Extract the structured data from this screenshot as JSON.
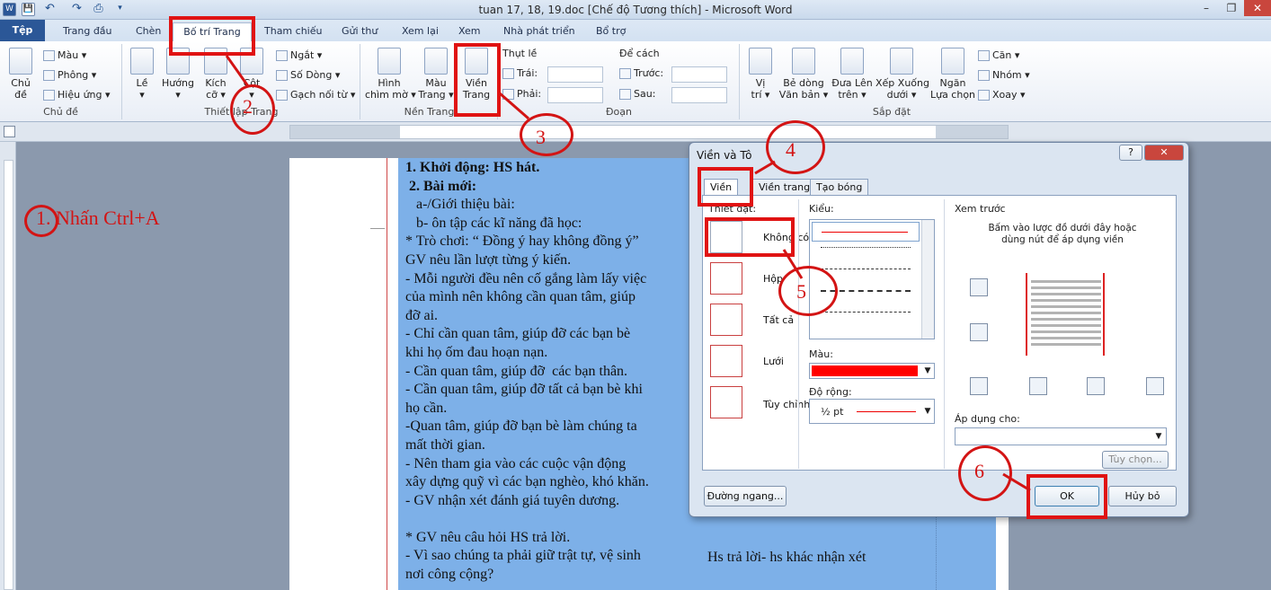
{
  "window": {
    "title": "tuan 17, 18, 19.doc [Chế độ Tương thích] - Microsoft Word",
    "minimize": "–",
    "restore": "❐",
    "close": "✕"
  },
  "qat": {
    "word_icon": "W",
    "save_icon": "💾",
    "undo_icon": "↶",
    "redo_icon": "↷",
    "print_icon": "⎙",
    "customize_icon": "▾"
  },
  "tabs": [
    "Tệp",
    "Trang đầu",
    "Chèn",
    "Bố trí Trang",
    "Tham chiếu",
    "Gửi thư",
    "Xem lại",
    "Xem",
    "Nhà phát triển",
    "Bổ trợ"
  ],
  "ribbon": {
    "themes": {
      "label": "Chủ đề",
      "big": "Chủ\nđề",
      "colors": "Màu ▾",
      "fonts": "Phông ▾",
      "effects": "Hiệu ứng ▾"
    },
    "page_setup": {
      "label": "Thiết lập Trang",
      "margins": "Lề\n▾",
      "orientation": "Hướng\n▾",
      "size": "Kích\ncỡ ▾",
      "columns": "Cột\n▾",
      "breaks": "Ngắt ▾",
      "line_numbers": "Số Dòng ▾",
      "hyphenation": "Gạch nối từ ▾"
    },
    "page_bg": {
      "label": "Nền Trang",
      "watermark": "Hình\nchìm mờ ▾",
      "page_color": "Màu\nTrang ▾",
      "page_borders": "Viền\nTrang"
    },
    "paragraph": {
      "label": "Đoạn",
      "indent": "Thụt lề",
      "left": "Trái:",
      "right": "Phải:",
      "spacing": "Để cách",
      "before": "Trước:",
      "after": "Sau:"
    },
    "arrange": {
      "label": "Sắp đặt",
      "position": "Vị\ntrí ▾",
      "wrap": "Bẻ dòng\nVăn bản ▾",
      "forward": "Đưa Lên\ntrên ▾",
      "backward": "Xếp Xuống\ndưới ▾",
      "pane": "Ngăn\nLựa chọn",
      "align": "Căn ▾",
      "group": "Nhóm ▾",
      "rotate": "Xoay ▾"
    }
  },
  "document": {
    "left_lines": [
      "1. Khởi động: HS hát.",
      " 2. Bài mới:",
      "   a-/Giới thiệu bài:",
      "   b- ôn tập các kĩ năng đã học:",
      "* Trò chơi: “ Đồng ý hay không đồng ý”",
      "GV nêu lần lượt từng ý kiến.",
      "- Mỗi người đều nên cố gắng làm lấy việc",
      "của mình nên không cần quan tâm, giúp",
      "đỡ ai.",
      "- Chỉ cần quan tâm, giúp đỡ các bạn bè",
      "khi họ ốm đau hoạn nạn.",
      "- Cần quan tâm, giúp đỡ  các bạn thân.",
      "- Cần quan tâm, giúp đỡ tất cả bạn bè khi",
      "họ cần.",
      "-Quan tâm, giúp đỡ bạn bè làm chúng ta",
      "mất thời gian.",
      "- Nên tham gia vào các cuộc vận động",
      "xây dựng quỹ vì các bạn nghèo, khó khăn.",
      "- GV nhận xét đánh giá tuyên dương.",
      "",
      "* GV nêu câu hỏi HS trả lời.",
      "- Vì sao chúng ta phải giữ trật tự, vệ sinh",
      "nơi công cộng?"
    ],
    "right_text": "Hs trả lời- hs khác nhận xét"
  },
  "dialog": {
    "title": "Viền và Tô",
    "help": "?",
    "close": "✕",
    "tabs": [
      "Viền",
      "Viền trang",
      "Tạo bóng"
    ],
    "setting_label": "Thiết đặt:",
    "settings": [
      "Không có",
      "Hộp",
      "Tất cả",
      "Lưới",
      "Tùy chỉnh"
    ],
    "style_label": "Kiểu:",
    "color_label": "Màu:",
    "width_label": "Độ rộng:",
    "width_value": "½ pt",
    "preview_label": "Xem trước",
    "preview_hint": "Bấm vào lược đồ dưới đây hoặc\ndùng nút để áp dụng viền",
    "apply_label": "Áp dụng cho:",
    "options_button": "Tùy chọn...",
    "horizontal_line_button": "Đường ngang...",
    "ok_button": "OK",
    "cancel_button": "Hủy bỏ",
    "border_color": "#ff0000"
  },
  "annotations": {
    "step1": "1. Nhấn Ctrl+A",
    "n2": "2",
    "n3": "3",
    "n4": "4",
    "n5": "5",
    "n6": "6"
  }
}
